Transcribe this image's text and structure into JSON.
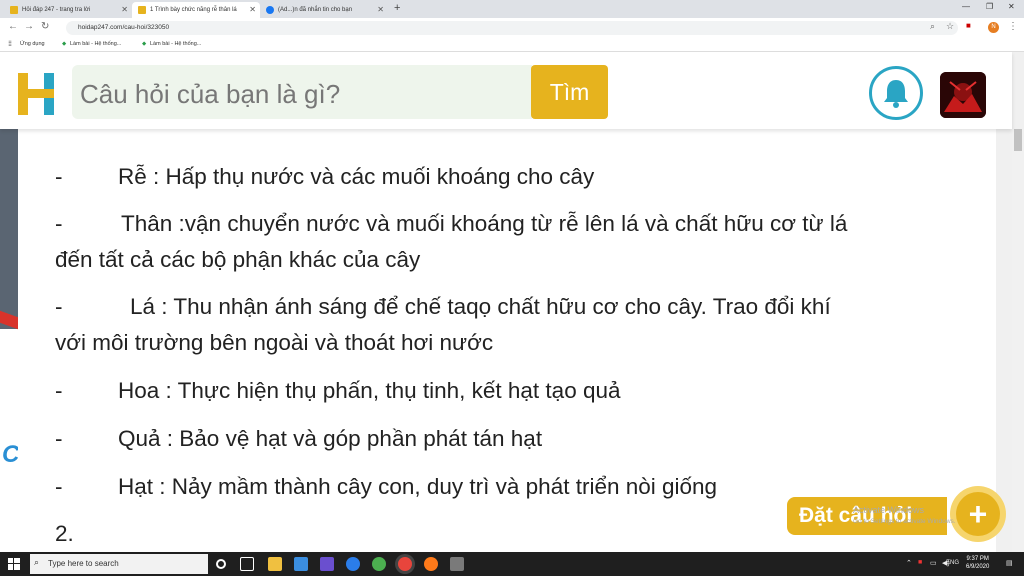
{
  "browser": {
    "tabs": [
      {
        "label": "Hỏi đáp 247 - trang tra lời",
        "active": false
      },
      {
        "label": "1 Trình bày chức năng rễ thân lá",
        "active": true
      },
      {
        "label": "(Ad...)n đã nhắn tin cho bạn",
        "active": false
      }
    ],
    "url": "hoidap247.com/cau-hoi/323050",
    "bookmarks": [
      "Ứng dụng",
      "Làm bài - Hệ thống...",
      "Làm bài - Hệ thống..."
    ]
  },
  "site": {
    "search_placeholder": "Câu hỏi của bạn là gì?",
    "search_button": "Tìm",
    "colors": {
      "accent": "#e6b31e",
      "bell": "#2aa5c4",
      "search_bg": "#eef5ec"
    }
  },
  "content": {
    "items": [
      {
        "dash": "-",
        "text": "Rễ : Hấp thụ nước và các muối khoáng cho cây",
        "cont": ""
      },
      {
        "dash": "-",
        "text": "Thân :vận chuyển nước và muối khoáng từ rễ lên lá và chất hữu cơ từ lá",
        "cont": "đến tất cả các bộ phận khác của cây"
      },
      {
        "dash": "-",
        "text": "Lá : Thu nhận ánh sáng để chế taqọ chất hữu cơ cho cây. Trao đổi khí",
        "cont": "với môi trường bên ngoài và thoát hơi nước"
      },
      {
        "dash": "-",
        "text": "Hoa : Thực hiện thụ phấn, thụ tinh, kết hạt tạo quả",
        "cont": ""
      },
      {
        "dash": "-",
        "text": "Quả  : Bảo vệ hạt và góp phần phát tán hạt",
        "cont": ""
      },
      {
        "dash": "-",
        "text": "Hạt : Nảy mầm thành cây con, duy trì và phát triển nòi giống",
        "cont": ""
      }
    ],
    "next_number": "2."
  },
  "ask_button": "Đặt câu hỏi",
  "watermark": {
    "line1": "Activate Windows",
    "line2": "Go to Settings to activate Windows."
  },
  "taskbar": {
    "search_placeholder": "Type here to search",
    "language": "ENG",
    "time": "9:37 PM",
    "date": "6/9/2020"
  }
}
